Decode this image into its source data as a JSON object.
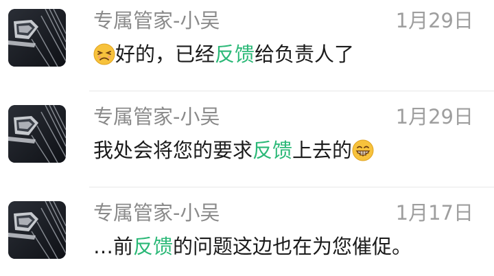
{
  "conversations": [
    {
      "sender": "专属管家-小吴",
      "date": "1月29日",
      "avatar_icon": "car-grille-logo-icon",
      "message": {
        "prefix_emoji": "persevering-face-emoji",
        "before": "好的，已经",
        "highlight": "反馈",
        "after": "给负责人了",
        "suffix_emoji": ""
      }
    },
    {
      "sender": "专属管家-小吴",
      "date": "1月29日",
      "avatar_icon": "car-grille-logo-icon",
      "message": {
        "prefix_emoji": "",
        "before": "我处会将您的要求",
        "highlight": "反馈",
        "after": "上去的",
        "suffix_emoji": "grinning-face-emoji"
      }
    },
    {
      "sender": "专属管家-小吴",
      "date": "1月17日",
      "avatar_icon": "car-grille-logo-icon",
      "message": {
        "prefix_emoji": "",
        "before": "…前",
        "highlight": "反馈",
        "after": "的问题这边也在为您催促。",
        "suffix_emoji": ""
      }
    }
  ],
  "colors": {
    "highlight": "#2bb877",
    "sender": "#8a8a8a",
    "date": "#9e9e9e",
    "message": "#1b1b1b",
    "divider": "#e7e7e7"
  }
}
